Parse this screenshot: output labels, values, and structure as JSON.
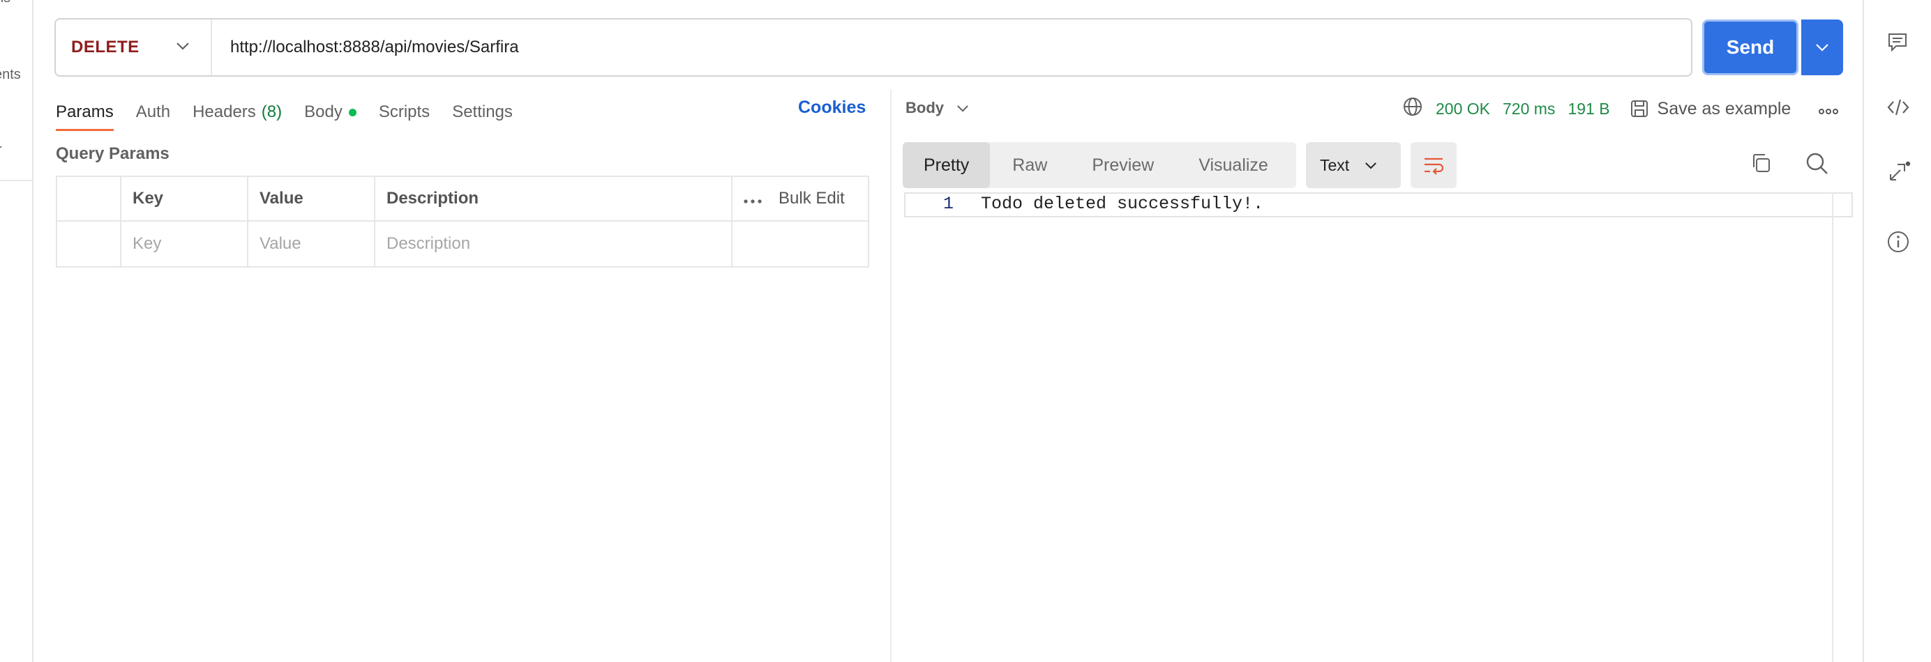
{
  "left_sidebar": {
    "fragments": [
      "ns",
      "ents",
      "r"
    ]
  },
  "request": {
    "method": "DELETE",
    "url": "http://localhost:8888/api/movies/Sarfira",
    "send_label": "Send"
  },
  "request_tabs": [
    {
      "label": "Params",
      "active": true
    },
    {
      "label": "Auth"
    },
    {
      "label": "Headers",
      "count": "(8)"
    },
    {
      "label": "Body",
      "dot": true
    },
    {
      "label": "Scripts"
    },
    {
      "label": "Settings"
    }
  ],
  "cookies_label": "Cookies",
  "query_params": {
    "title": "Query Params",
    "headers": [
      "Key",
      "Value",
      "Description"
    ],
    "bulk_edit": "Bulk Edit",
    "placeholders": [
      "Key",
      "Value",
      "Description"
    ]
  },
  "response": {
    "body_label": "Body",
    "status": "200 OK",
    "time": "720 ms",
    "size": "191 B",
    "save_example": "Save as example",
    "view_tabs": [
      "Pretty",
      "Raw",
      "Preview",
      "Visualize"
    ],
    "active_view": "Pretty",
    "format": "Text",
    "line_number": "1",
    "content": "Todo deleted successfully!."
  },
  "colors": {
    "accent": "#2f71e3",
    "method": "#8f1d1d",
    "status_green": "#1f8a47",
    "tab_underline": "#f26b3a"
  },
  "icons": {
    "right_sidebar": [
      "comment-icon",
      "code-icon",
      "fork-icon",
      "info-icon"
    ]
  }
}
